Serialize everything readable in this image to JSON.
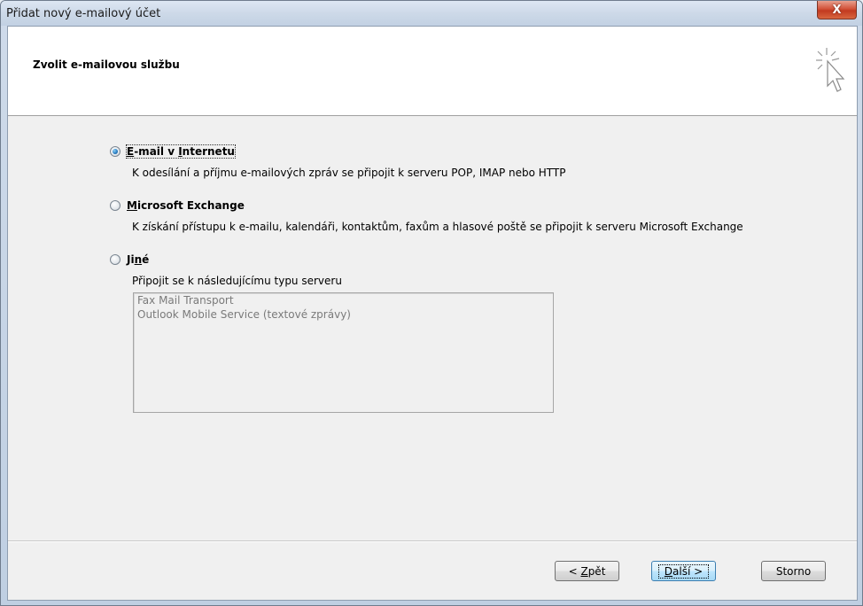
{
  "window": {
    "title": "Přidat nový e-mailový účet",
    "close_label": "X"
  },
  "header": {
    "title": "Zvolit e-mailovou službu"
  },
  "options": [
    {
      "label_pre": "",
      "label_u": "E",
      "label_mid": "-mail v ",
      "label_u2": "I",
      "label_post": "nternetu",
      "description": "K odesílání a příjmu e-mailových zpráv se připojit k serveru POP, IMAP nebo HTTP",
      "selected": true
    },
    {
      "label_u": "M",
      "label_post": "icrosoft Exchange",
      "description": "K získání přístupu k e-mailu, kalendáři, kontaktům, faxům a hlasové poště se připojit k serveru Microsoft Exchange",
      "selected": false
    },
    {
      "label_pre": "Ji",
      "label_u": "n",
      "label_post": "é",
      "description": "Připojit se k následujícímu typu serveru",
      "selected": false
    }
  ],
  "server_types": [
    "Fax Mail Transport",
    "Outlook Mobile Service (textové zprávy)"
  ],
  "buttons": {
    "back_pre": "< ",
    "back_u": "Z",
    "back_post": "pět",
    "next_u": "D",
    "next_post": "alší >",
    "cancel": "Storno"
  }
}
